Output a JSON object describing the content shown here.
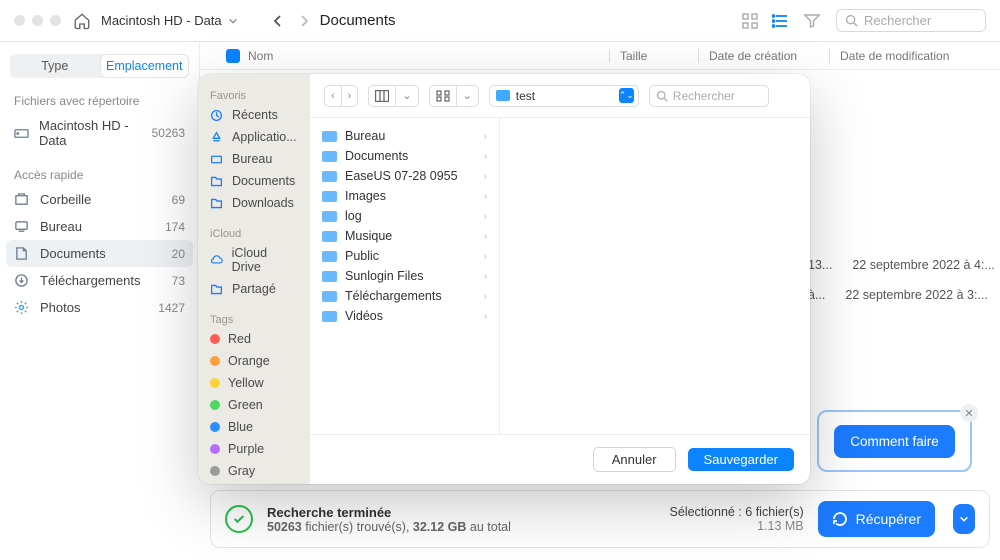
{
  "header": {
    "drive": "Macintosh HD - Data",
    "breadcrumb": "Documents",
    "search_placeholder": "Rechercher"
  },
  "columns": {
    "name": "Nom",
    "size": "Taille",
    "created": "Date de création",
    "modified": "Date de modification"
  },
  "sidebar": {
    "tabs": {
      "type": "Type",
      "location": "Emplacement"
    },
    "repo_label": "Fichiers avec répertoire",
    "drive": {
      "label": "Macintosh HD - Data",
      "count": "50263"
    },
    "quick_label": "Accès rapide",
    "items": [
      {
        "label": "Corbeille",
        "count": "69"
      },
      {
        "label": "Bureau",
        "count": "174"
      },
      {
        "label": "Documents",
        "count": "20"
      },
      {
        "label": "Téléchargements",
        "count": "73"
      },
      {
        "label": "Photos",
        "count": "1427"
      }
    ]
  },
  "peek_rows": [
    {
      "date1": "13...",
      "date2": "22 septembre 2022 à 4:..."
    },
    {
      "date1": "à...",
      "date2": "22 septembre 2022 à 3:..."
    }
  ],
  "dialog": {
    "sections": {
      "fav": "Favoris",
      "icloud": "iCloud",
      "tags": "Tags"
    },
    "fav_items": [
      "Récents",
      "Applicatio...",
      "Bureau",
      "Documents",
      "Downloads"
    ],
    "icloud_items": [
      "iCloud Drive",
      "Partagé"
    ],
    "tags": [
      {
        "label": "Red",
        "color": "#ff5b56"
      },
      {
        "label": "Orange",
        "color": "#ff9f3a"
      },
      {
        "label": "Yellow",
        "color": "#ffd23a"
      },
      {
        "label": "Green",
        "color": "#4cd964"
      },
      {
        "label": "Blue",
        "color": "#2b8fff"
      },
      {
        "label": "Purple",
        "color": "#b66cff"
      },
      {
        "label": "Gray",
        "color": "#9a9a9a"
      }
    ],
    "path": "test",
    "search_placeholder": "Rechercher",
    "folders": [
      "Bureau",
      "Documents",
      "EaseUS 07-28 0955",
      "Images",
      "log",
      "Musique",
      "Public",
      "Sunlogin Files",
      "Téléchargements",
      "Vidéos"
    ],
    "cancel": "Annuler",
    "save": "Sauvegarder"
  },
  "help": {
    "label": "Comment faire"
  },
  "status": {
    "title": "Recherche terminée",
    "count": "50263",
    "found": " fichier(s) trouvé(s), ",
    "size": "32.12 GB",
    "total_suffix": " au total",
    "selected_label": "Sélectionné : 6 fichier(s)",
    "selected_size": "1.13 MB",
    "recover": "Récupérer"
  }
}
